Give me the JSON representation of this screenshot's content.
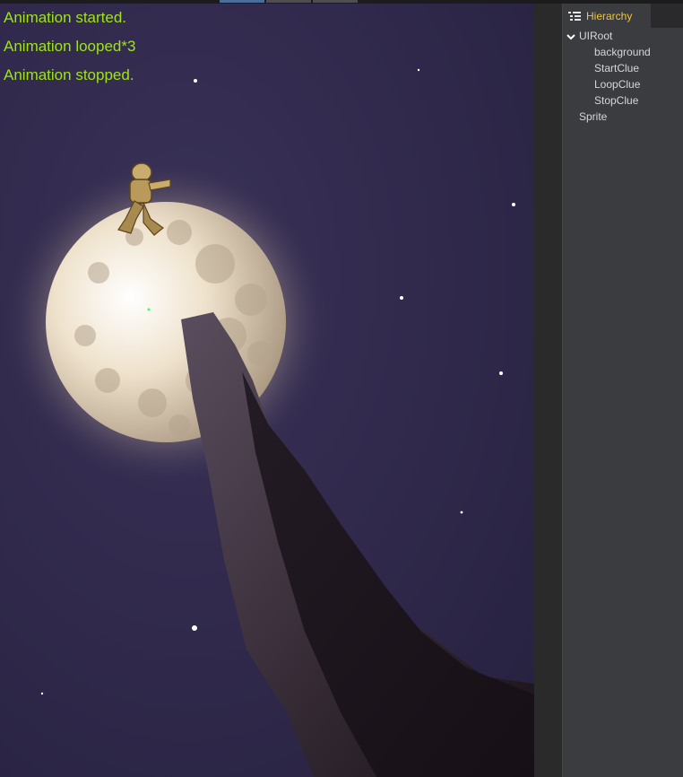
{
  "scene": {
    "clues": {
      "start": "Animation started.",
      "loop": "Animation looped*3",
      "stop": "Animation stopped."
    },
    "colors": {
      "clue_text": "#9ee31a",
      "sky": "#2e2848",
      "moon": "#f2e6d2"
    }
  },
  "hierarchy": {
    "tab_title": "Hierarchy",
    "tab_icon": "hierarchy-list-icon",
    "root": {
      "label": "UIRoot",
      "expanded": true,
      "children": [
        "background",
        "StartClue",
        "LoopClue",
        "StopClue"
      ]
    },
    "sibling": "Sprite"
  }
}
